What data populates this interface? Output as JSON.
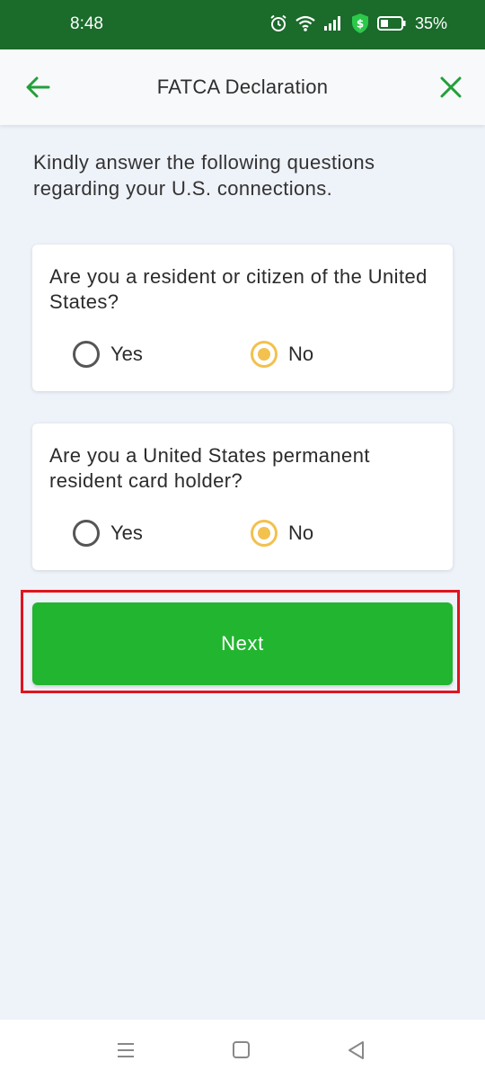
{
  "status_bar": {
    "time": "8:48",
    "battery_percent": "35%",
    "icons": [
      "alarm-icon",
      "wifi-icon",
      "signal-icon",
      "shield-dollar-icon",
      "battery-icon"
    ]
  },
  "header": {
    "title": "FATCA Declaration",
    "back_icon": "arrow-left-icon",
    "close_icon": "close-icon",
    "accent_color": "#22a03a"
  },
  "intro_text": "Kindly answer the following questions regarding your U.S. connections.",
  "questions": [
    {
      "text": "Are you a resident or citizen of the United States?",
      "options": [
        {
          "label": "Yes",
          "selected": false
        },
        {
          "label": "No",
          "selected": true
        }
      ]
    },
    {
      "text": "Are you a United States permanent resident card holder?",
      "options": [
        {
          "label": "Yes",
          "selected": false
        },
        {
          "label": "No",
          "selected": true
        }
      ]
    }
  ],
  "next_button": {
    "label": "Next",
    "color": "#22b530",
    "highlight_color": "#e0141e"
  },
  "nav_bar": {
    "icons": [
      "menu-icon",
      "home-icon",
      "back-triangle-icon"
    ]
  }
}
